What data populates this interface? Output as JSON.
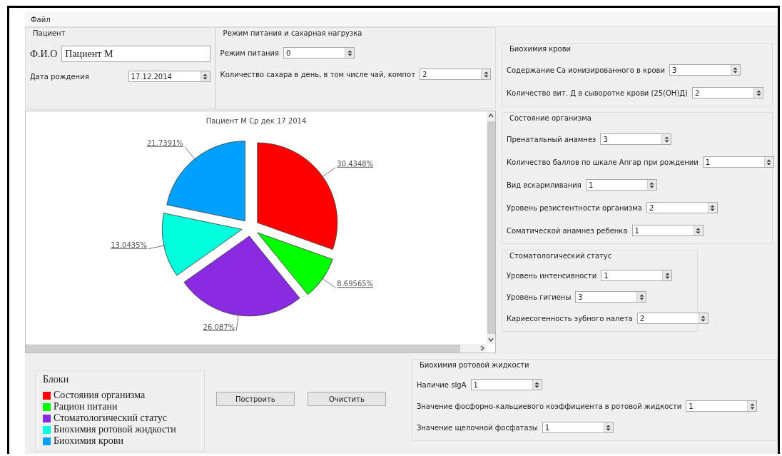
{
  "menu": [
    "Файл"
  ],
  "patient": {
    "title": "Пациент",
    "name_label": "Ф.И.О",
    "name_value": "Пациент М",
    "birth_label": "Дата рождения",
    "birth_value": "17.12.2014"
  },
  "nutrition": {
    "title": "Режим питания и сахарная нагрузка",
    "fields": [
      {
        "label": "Режим питания",
        "value": "0"
      },
      {
        "label": "Количество сахара в день, в том числе чай, компот",
        "value": "2"
      }
    ]
  },
  "chart": {
    "chart_data": {
      "type": "pie",
      "title": "Пациент М Ср дек 17 2014",
      "values": [
        30.4348,
        8.69565,
        26.087,
        13.0435,
        21.7391
      ],
      "data_labels": true,
      "value_labels": [
        "30.4348%",
        "8.69565%",
        "26.087%",
        "13.0435%",
        "21.7391%"
      ]
    }
  },
  "blood": {
    "title": "Биохимия крови",
    "fields": [
      {
        "label": "Содержание Ca ионизированного в крови",
        "value": "3"
      },
      {
        "label": "Количество вит. Д в сыворотке крови (25(OH)Д)",
        "value": "2"
      }
    ]
  },
  "organism": {
    "title": "Состояние организма",
    "fields": [
      {
        "label": "Пренатальный анамнез",
        "value": "3"
      },
      {
        "label": "Количество баллов по шкале Апгар при рождении",
        "value": "1"
      },
      {
        "label": "Вид вскармливания",
        "value": "1"
      },
      {
        "label": "Уровень резистентности организма",
        "value": "2"
      },
      {
        "label": "Соматической анамнез ребенка",
        "value": "1"
      }
    ]
  },
  "dental": {
    "title": "Стоматологический статус",
    "fields": [
      {
        "label": "Уровень интенсивности",
        "value": "1"
      },
      {
        "label": "Уровень гигиены",
        "value": "3"
      },
      {
        "label": "Кариесогенность зубного налета",
        "value": "2"
      }
    ]
  },
  "legend": {
    "title": "Блоки",
    "items": [
      {
        "label": "Состояния организма",
        "color": "#ff0000"
      },
      {
        "label": "Рацион питани",
        "color": "#00ff00"
      },
      {
        "label": "Стоматологический статус",
        "color": "#8a2be2"
      },
      {
        "label": "Биохимия ротовой жидкости",
        "color": "#00ffdd"
      },
      {
        "label": "Биохимия крови",
        "color": "#00a0ff"
      }
    ]
  },
  "buttons": [
    "Построить",
    "Очистить"
  ],
  "oral": {
    "title": "Биохимия ротовой жидкости",
    "fields": [
      {
        "label": "Наличие sIgA",
        "value": "1"
      },
      {
        "label": "Значение фосфорно-кальциевого коэффициента в ротовой жидкости",
        "value": "1"
      },
      {
        "label": "Значение щелочной фосфатазы",
        "value": "1"
      }
    ]
  }
}
